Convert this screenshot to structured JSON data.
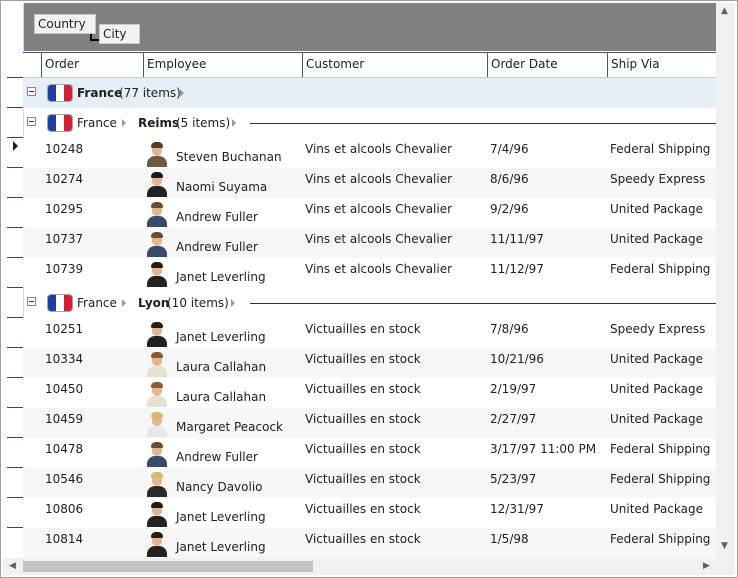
{
  "group_panel": {
    "chips": [
      "Country",
      "City"
    ]
  },
  "columns": [
    "Order",
    "Employee",
    "Customer",
    "Order Date",
    "Ship Via"
  ],
  "groups": [
    {
      "label": "France",
      "count_text": "(77 items)"
    },
    {
      "parent": "France",
      "label": "Reims",
      "count_text": "(5 items)"
    },
    {
      "parent": "France",
      "label": "Lyon",
      "count_text": "(10 items)"
    }
  ],
  "reims_rows": [
    {
      "order": "10248",
      "employee": "Steven Buchanan",
      "customer": "Vins et alcools Chevalier",
      "date": "7/4/96",
      "ship": "Federal Shipping"
    },
    {
      "order": "10274",
      "employee": "Naomi Suyama",
      "customer": "Vins et alcools Chevalier",
      "date": "8/6/96",
      "ship": "Speedy Express"
    },
    {
      "order": "10295",
      "employee": "Andrew Fuller",
      "customer": "Vins et alcools Chevalier",
      "date": "9/2/96",
      "ship": "United Package"
    },
    {
      "order": "10737",
      "employee": "Andrew Fuller",
      "customer": "Vins et alcools Chevalier",
      "date": "11/11/97",
      "ship": "United Package"
    },
    {
      "order": "10739",
      "employee": "Janet Leverling",
      "customer": "Vins et alcools Chevalier",
      "date": "11/12/97",
      "ship": "Federal Shipping"
    }
  ],
  "lyon_rows": [
    {
      "order": "10251",
      "employee": "Janet Leverling",
      "customer": "Victuailles en stock",
      "date": "7/8/96",
      "ship": "Speedy Express"
    },
    {
      "order": "10334",
      "employee": "Laura Callahan",
      "customer": "Victuailles en stock",
      "date": "10/21/96",
      "ship": "United Package"
    },
    {
      "order": "10450",
      "employee": "Laura Callahan",
      "customer": "Victuailles en stock",
      "date": "2/19/97",
      "ship": "United Package"
    },
    {
      "order": "10459",
      "employee": "Margaret Peacock",
      "customer": "Victuailles en stock",
      "date": "2/27/97",
      "ship": "United Package"
    },
    {
      "order": "10478",
      "employee": "Andrew Fuller",
      "customer": "Victuailles en stock",
      "date": "3/17/97 11:00 PM",
      "ship": "Federal Shipping"
    },
    {
      "order": "10546",
      "employee": "Nancy Davolio",
      "customer": "Victuailles en stock",
      "date": "5/23/97",
      "ship": "Federal Shipping"
    },
    {
      "order": "10806",
      "employee": "Janet Leverling",
      "customer": "Victuailles en stock",
      "date": "12/31/97",
      "ship": "United Package"
    },
    {
      "order": "10814",
      "employee": "Janet Leverling",
      "customer": "Victuailles en stock",
      "date": "1/5/98",
      "ship": "Federal Shipping"
    }
  ],
  "icons": {
    "expander": "collapse-icon",
    "flag": "france-flag-icon",
    "chevron": "chevron-right-icon",
    "current_row": "current-row-arrow-icon"
  },
  "colors": {
    "group_panel_bg": "#808080",
    "group_row_bg": "#e6eef8",
    "flag_blue": "#1f3fa0",
    "flag_red": "#d32030"
  }
}
